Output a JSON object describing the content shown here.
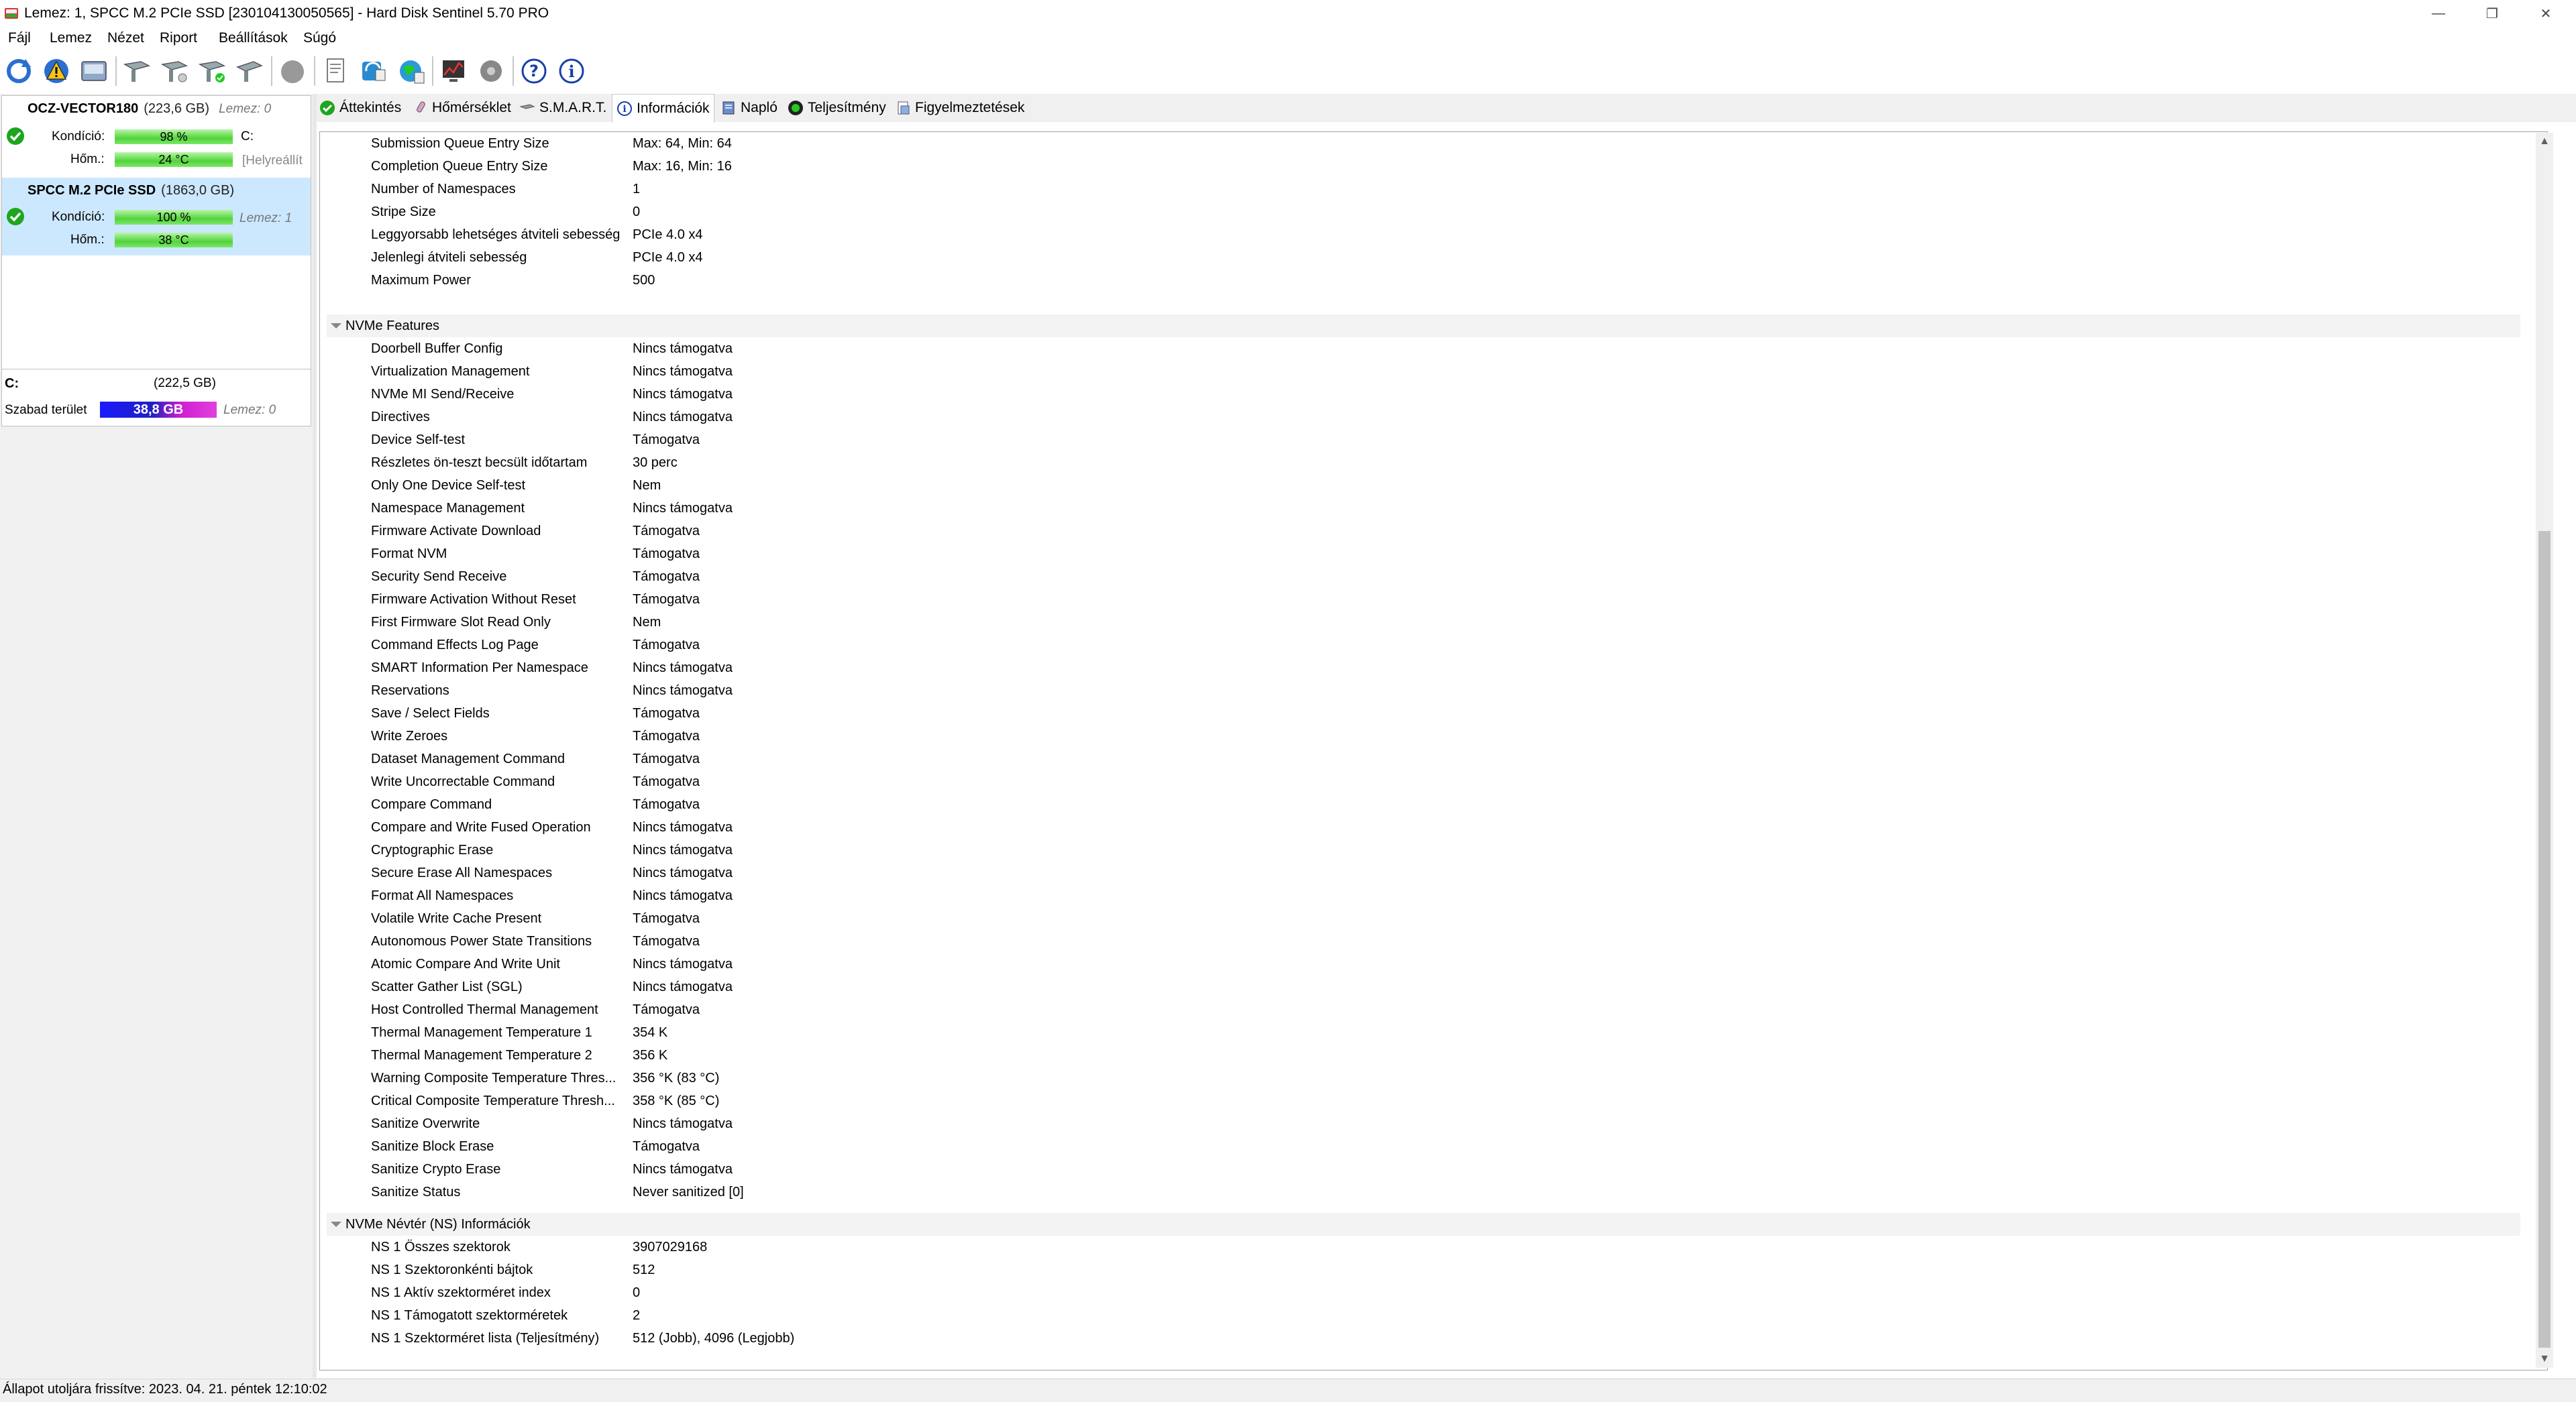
{
  "window": {
    "title": "Lemez: 1, SPCC M.2 PCIe SSD [230104130050565]  -  Hard Disk Sentinel 5.70 PRO",
    "minimize_glyph": "—",
    "restore_glyph": "❐",
    "close_glyph": "✕"
  },
  "menu": [
    "Fájl",
    "Lemez",
    "Nézet",
    "Riport",
    "Beállítások",
    "Súgó"
  ],
  "toolbar_icons": [
    "refresh-icon",
    "warning-icon",
    "disk-icon",
    "test-icon",
    "test-icon",
    "test-ok-icon",
    "test-icon",
    "blob-icon",
    "report-icon",
    "send-report-icon",
    "web-report-icon",
    "monitor-icon",
    "disk-settings-icon",
    "help-icon",
    "info-icon"
  ],
  "disks": [
    {
      "name": "OCZ-VECTOR180",
      "size": "(223,6 GB)",
      "sub": "Lemez: 0",
      "kondicio_label": "Kondíció:",
      "kondicio": "98 %",
      "kondicio_pct": 98,
      "hom_label": "Hőm.:",
      "hom": "24 °C",
      "drive_letter": "C:",
      "extra": "[Helyreállít"
    },
    {
      "name": "SPCC M.2 PCIe SSD",
      "size": "(1863,0 GB)",
      "sub": "Lemez: 1",
      "kondicio_label": "Kondíció:",
      "kondicio": "100 %",
      "kondicio_pct": 100,
      "hom_label": "Hőm.:",
      "hom": "38 °C"
    }
  ],
  "volume": {
    "name": "C:",
    "size": "(222,5 GB)",
    "free_label": "Szabad terület",
    "free": "38,8 GB",
    "sub": "Lemez: 0"
  },
  "tabs": [
    "Áttekintés",
    "Hőmérséklet",
    "S.M.A.R.T.",
    "Információk",
    "Napló",
    "Teljesítmény",
    "Figyelmeztetések"
  ],
  "active_tab": "Információk",
  "rows_top": [
    [
      "Submission Queue Entry Size",
      "Max: 64, Min: 64"
    ],
    [
      "Completion Queue Entry Size",
      "Max: 16, Min: 16"
    ],
    [
      "Number of Namespaces",
      "1"
    ],
    [
      "Stripe Size",
      "0"
    ],
    [
      "Leggyorsabb lehetséges átviteli sebesség",
      "PCIe 4.0 x4"
    ],
    [
      "Jelenlegi átviteli sebesség",
      "PCIe 4.0 x4"
    ],
    [
      "Maximum Power",
      "500"
    ]
  ],
  "section_features": "NVMe Features",
  "rows_features": [
    [
      "Doorbell Buffer Config",
      "Nincs támogatva"
    ],
    [
      "Virtualization Management",
      "Nincs támogatva"
    ],
    [
      "NVMe MI Send/Receive",
      "Nincs támogatva"
    ],
    [
      "Directives",
      "Nincs támogatva"
    ],
    [
      "Device Self-test",
      "Támogatva"
    ],
    [
      "Részletes ön-teszt becsült időtartam",
      "30 perc"
    ],
    [
      "Only One Device Self-test",
      "Nem"
    ],
    [
      "Namespace Management",
      "Nincs támogatva"
    ],
    [
      "Firmware Activate Download",
      "Támogatva"
    ],
    [
      "Format NVM",
      "Támogatva"
    ],
    [
      "Security Send Receive",
      "Támogatva"
    ],
    [
      "Firmware Activation Without Reset",
      "Támogatva"
    ],
    [
      "First Firmware Slot Read Only",
      "Nem"
    ],
    [
      "Command Effects Log Page",
      "Támogatva"
    ],
    [
      "SMART Information Per Namespace",
      "Nincs támogatva"
    ],
    [
      "Reservations",
      "Nincs támogatva"
    ],
    [
      "Save / Select Fields",
      "Támogatva"
    ],
    [
      "Write Zeroes",
      "Támogatva"
    ],
    [
      "Dataset Management Command",
      "Támogatva"
    ],
    [
      "Write Uncorrectable Command",
      "Támogatva"
    ],
    [
      "Compare Command",
      "Támogatva"
    ],
    [
      "Compare and Write Fused Operation",
      "Nincs támogatva"
    ],
    [
      "Cryptographic Erase",
      "Nincs támogatva"
    ],
    [
      "Secure Erase All Namespaces",
      "Nincs támogatva"
    ],
    [
      "Format All Namespaces",
      "Nincs támogatva"
    ],
    [
      "Volatile Write Cache Present",
      "Támogatva"
    ],
    [
      "Autonomous Power State Transitions",
      "Támogatva"
    ],
    [
      "Atomic Compare And Write Unit",
      "Nincs támogatva"
    ],
    [
      "Scatter Gather List (SGL)",
      "Nincs támogatva"
    ],
    [
      "Host Controlled Thermal Management",
      "Támogatva"
    ],
    [
      "Thermal Management Temperature 1",
      "354 K"
    ],
    [
      "Thermal Management Temperature 2",
      "356 K"
    ],
    [
      "Warning Composite Temperature Thres...",
      "356 °K (83 °C)"
    ],
    [
      "Critical Composite Temperature Thresh...",
      "358 °K (85 °C)"
    ],
    [
      "Sanitize Overwrite",
      "Nincs támogatva"
    ],
    [
      "Sanitize Block Erase",
      "Támogatva"
    ],
    [
      "Sanitize Crypto Erase",
      "Nincs támogatva"
    ],
    [
      "Sanitize Status",
      "Never sanitized [0]"
    ]
  ],
  "section_ns": "NVMe Névtér (NS) Információk",
  "rows_ns": [
    [
      "NS 1 Összes szektorok",
      "3907029168"
    ],
    [
      "NS 1 Szektoronkénti bájtok",
      "512"
    ],
    [
      "NS 1 Aktív szektorméret index",
      "0"
    ],
    [
      "NS 1 Támogatott szektorméretek",
      "2"
    ],
    [
      "NS 1 Szektorméret lista (Teljesítmény)",
      "512 (Jobb), 4096 (Legjobb)"
    ]
  ],
  "scroll": {
    "up": "▲",
    "down": "▼"
  },
  "status": "Állapot utoljára frissítve: 2023. 04. 21. péntek 12:10:02",
  "colors": {
    "selected_disk": "#cce8ff",
    "good_bar": "#52d43a",
    "free_bar": "#2020c0"
  }
}
